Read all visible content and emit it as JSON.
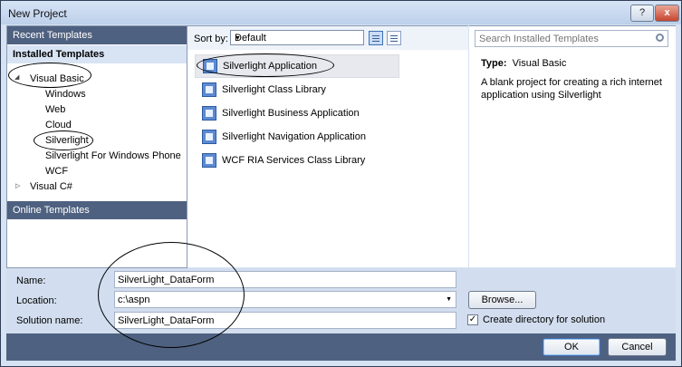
{
  "window": {
    "title": "New Project",
    "help_label": "?",
    "close_label": "x"
  },
  "left_panel": {
    "recent_label": "Recent Templates",
    "installed_label": "Installed Templates",
    "tree": [
      {
        "label": "Visual Basic"
      },
      {
        "label": "Windows"
      },
      {
        "label": "Web"
      },
      {
        "label": "Cloud"
      },
      {
        "label": "Silverlight"
      },
      {
        "label": "Silverlight For Windows Phone"
      },
      {
        "label": "WCF"
      },
      {
        "label": "Visual C#"
      }
    ],
    "online_label": "Online Templates",
    "expanded_arrow": "◢",
    "collapsed_arrow": "▷"
  },
  "center_panel": {
    "sort_label": "Sort by:",
    "sort_value": "Default",
    "sort_caret": "▼",
    "templates": [
      {
        "label": "Silverlight Application",
        "icon": "silverlight-app-icon"
      },
      {
        "label": "Silverlight Class Library",
        "icon": "class-library-icon"
      },
      {
        "label": "Silverlight Business Application",
        "icon": "business-app-icon"
      },
      {
        "label": "Silverlight Navigation Application",
        "icon": "navigation-app-icon"
      },
      {
        "label": "WCF RIA Services Class Library",
        "icon": "ria-services-icon"
      }
    ]
  },
  "right_panel": {
    "search_placeholder": "Search Installed Templates",
    "type_label": "Type:",
    "type_value": "Visual Basic",
    "description": "A blank project for creating a rich internet application using Silverlight"
  },
  "form": {
    "name_label": "Name:",
    "name_value": "SilverLight_DataForm",
    "location_label": "Location:",
    "location_value": "c:\\aspn",
    "location_caret": "▼",
    "solution_label": "Solution name:",
    "solution_value": "SilverLight_DataForm",
    "browse_label": "Browse...",
    "create_dir_label": "Create directory for solution",
    "create_dir_checked": true,
    "check_mark": "✓"
  },
  "buttons": {
    "ok": "OK",
    "cancel": "Cancel"
  }
}
